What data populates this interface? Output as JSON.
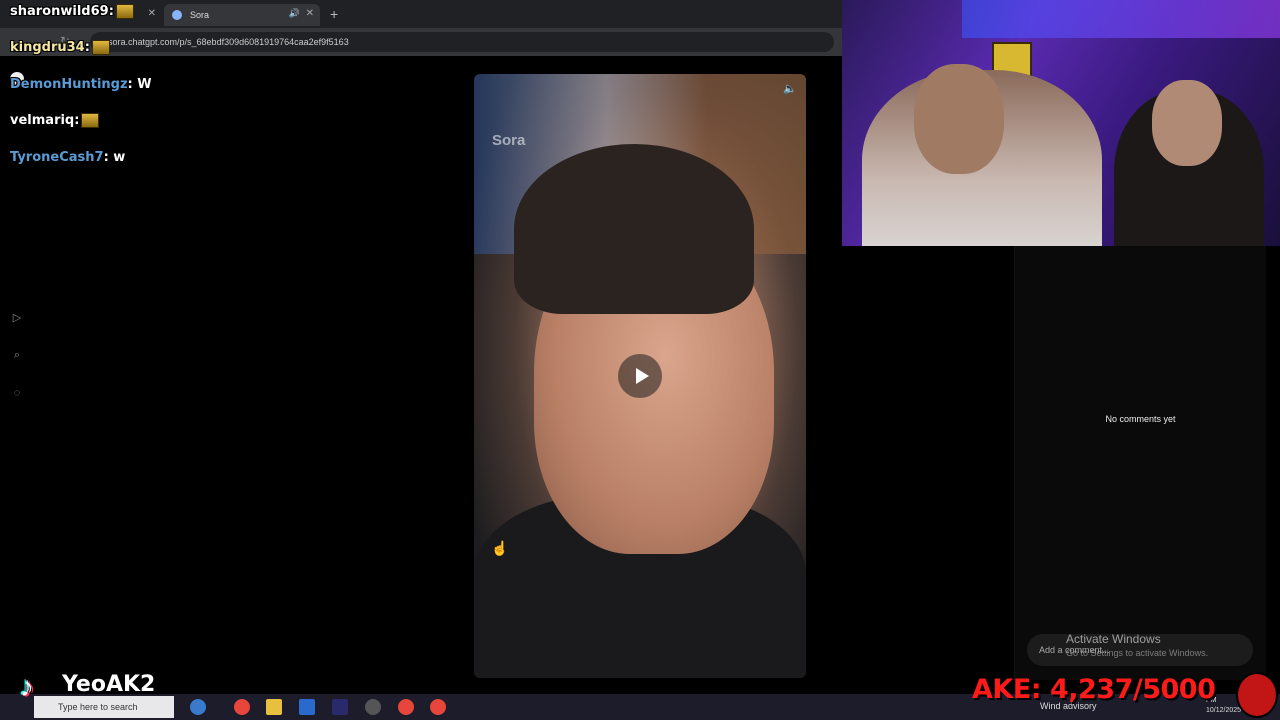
{
  "browser": {
    "tabs": [
      {
        "title": ""
      },
      {
        "title": "Sora"
      }
    ],
    "new_tab_symbol": "+",
    "url": "sora.chatgpt.com/p/s_68ebdf309d6081919764caa2ef9f5163"
  },
  "chat": {
    "messages": [
      {
        "user": "sharonwild69",
        "text": ":",
        "color": "#ffffff",
        "emote": true
      },
      {
        "user": "kingdru34",
        "text": ":",
        "color": "#f5e6a0",
        "emote": true
      },
      {
        "user": "DemonHuntingz",
        "text": ": W",
        "color": "#5b9bd5",
        "emote": false
      },
      {
        "user": "velmariq",
        "text": ":",
        "color": "#ffffff",
        "emote": true
      },
      {
        "user": "TyroneCash7",
        "text": ": w",
        "color": "#5b9bd5",
        "emote": false
      }
    ]
  },
  "sora": {
    "nav_icons": [
      "play-circle-icon",
      "search-icon",
      "bell-icon"
    ],
    "watermark": "Sora",
    "comments_empty": "No comments yet",
    "comment_placeholder": "Add a comment..."
  },
  "windows": {
    "activate_title": "Activate Windows",
    "activate_sub": "Go to Settings to activate Windows.",
    "search_placeholder": "Type here to search",
    "tray_text": "Wind advisory",
    "clock_time": "PM",
    "clock_date": "10/12/2025"
  },
  "overlay": {
    "tiktok_name": "YeoAK2",
    "goal_text": "AKE: 4,237/5000"
  },
  "colors": {
    "goal": "#ff1a1a",
    "chat_blue": "#5b9bd5"
  }
}
